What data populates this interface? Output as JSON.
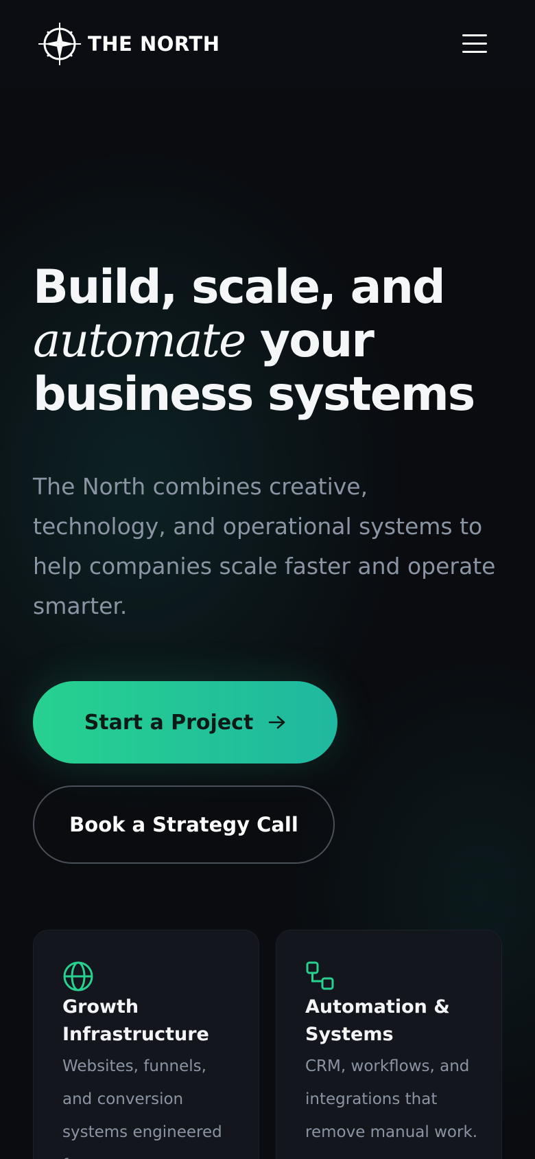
{
  "header": {
    "brand": "THE NORTH",
    "logo_icon": "compass-icon",
    "menu_icon": "hamburger-menu-icon"
  },
  "hero": {
    "headline_line1": "Build, scale, and",
    "headline_emphasis": "automate",
    "headline_line2_rest": " your",
    "headline_line3": "business systems",
    "subcopy": "The North combines creative, technology, and operational systems to help companies scale faster and operate smarter."
  },
  "actions": {
    "primary_label": "Start a Project",
    "primary_icon": "arrow-right-icon",
    "secondary_label": "Book a Strategy Call"
  },
  "features": [
    {
      "icon": "globe-icon",
      "title": "Growth Infrastructure",
      "description": "Websites, funnels, and conversion systems engineered for"
    },
    {
      "icon": "workflow-icon",
      "title": "Automation & Systems",
      "description": "CRM, workflows, and integrations that remove manual work."
    }
  ],
  "colors": {
    "background": "#0a0c10",
    "accent_start": "#27d18f",
    "accent_end": "#1fb8a0",
    "muted_text": "#8a94a3",
    "card_bg": "#13161c"
  }
}
